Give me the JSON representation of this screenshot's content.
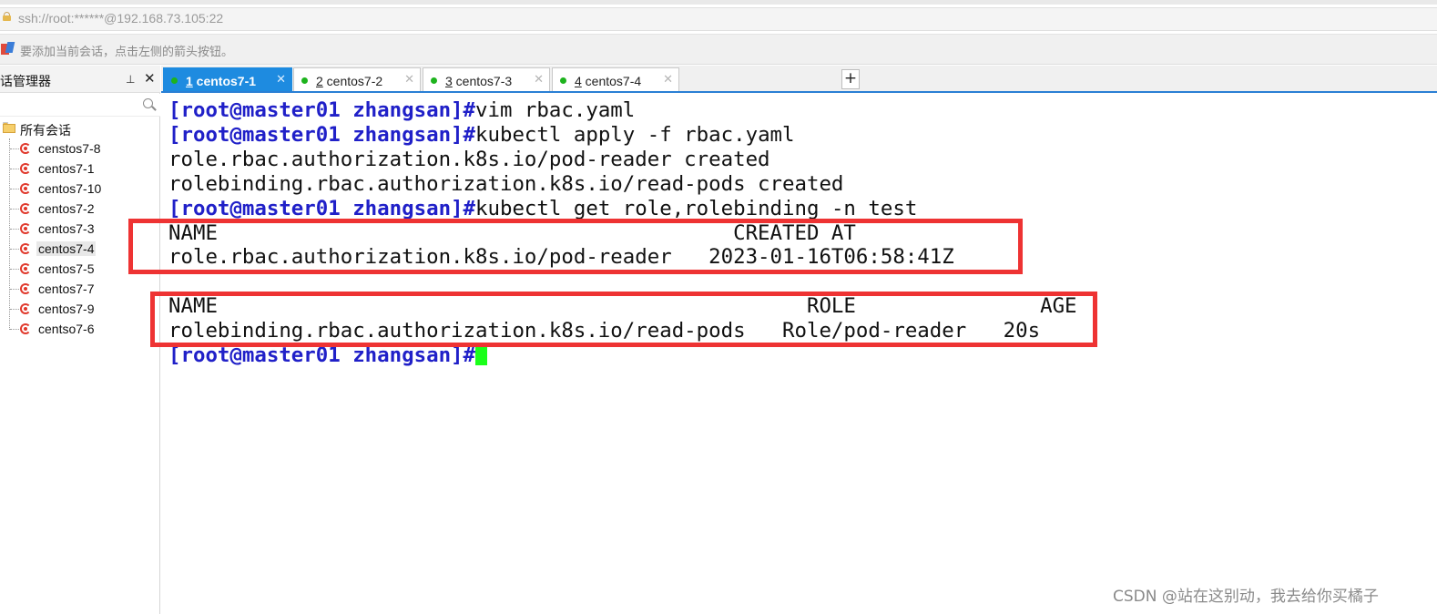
{
  "address_bar": {
    "url": "ssh://root:******@192.168.73.105:22",
    "icon": "lock-icon"
  },
  "hint_bar": {
    "text": "要添加当前会话，点击左侧的箭头按钮。",
    "icon": "bookmark-icon"
  },
  "sidebar": {
    "title": "话管理器",
    "pin_symbol": "⊥",
    "close_symbol": "✕",
    "root_label": "所有会话",
    "sessions": [
      {
        "label": "censtos7-8"
      },
      {
        "label": "centos7-1"
      },
      {
        "label": "centos7-10"
      },
      {
        "label": "centos7-2"
      },
      {
        "label": "centos7-3"
      },
      {
        "label": "centos7-4",
        "selected": true
      },
      {
        "label": "centos7-5"
      },
      {
        "label": "centos7-7"
      },
      {
        "label": "centos7-9"
      },
      {
        "label": "centso7-6"
      }
    ]
  },
  "tabs": [
    {
      "num": "1",
      "label": " centos7-1",
      "active": true,
      "close": "✕"
    },
    {
      "num": "2",
      "label": " centos7-2",
      "active": false,
      "close": "✕"
    },
    {
      "num": "3",
      "label": " centos7-3",
      "active": false,
      "close": "✕"
    },
    {
      "num": "4",
      "label": " centos7-4",
      "active": false,
      "close": "✕"
    }
  ],
  "tab_add_symbol": "+",
  "terminal": {
    "prompt": "[root@master01 zhangsan]#",
    "lines": [
      {
        "prompt": true,
        "text": "vim rbac.yaml"
      },
      {
        "prompt": true,
        "text": "kubectl apply -f rbac.yaml"
      },
      {
        "prompt": false,
        "text": "role.rbac.authorization.k8s.io/pod-reader created"
      },
      {
        "prompt": false,
        "text": "rolebinding.rbac.authorization.k8s.io/read-pods created"
      },
      {
        "prompt": true,
        "text": "kubectl get role,rolebinding -n test"
      },
      {
        "prompt": false,
        "text": "NAME                                          CREATED AT"
      },
      {
        "prompt": false,
        "text": "role.rbac.authorization.k8s.io/pod-reader   2023-01-16T06:58:41Z"
      },
      {
        "prompt": false,
        "text": ""
      },
      {
        "prompt": false,
        "text": "NAME                                                ROLE               AGE"
      },
      {
        "prompt": false,
        "text": "rolebinding.rbac.authorization.k8s.io/read-pods   Role/pod-reader   20s"
      },
      {
        "prompt": true,
        "text": ""
      }
    ],
    "highlight_color": "#ee3333",
    "cursor_color": "#1aff1a"
  },
  "watermark": "CSDN @站在这别动，我去给你买橘子"
}
